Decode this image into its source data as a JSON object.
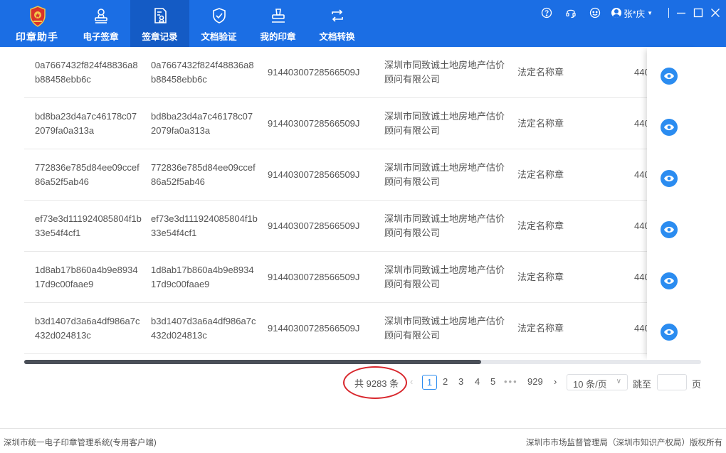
{
  "brand": {
    "name": "印章助手"
  },
  "nav": [
    {
      "label": "电子签章",
      "icon": "user-stamp-icon",
      "active": false
    },
    {
      "label": "签章记录",
      "icon": "record-doc-icon",
      "active": true
    },
    {
      "label": "文档验证",
      "icon": "shield-check-icon",
      "active": false
    },
    {
      "label": "我的印章",
      "icon": "seal-icon",
      "active": false
    },
    {
      "label": "文档转换",
      "icon": "convert-icon",
      "active": false
    }
  ],
  "topbar": {
    "username": "张*庆",
    "icons": [
      "help-icon",
      "headset-icon",
      "smile-icon"
    ]
  },
  "colors": {
    "header": "#1b6ee4",
    "active_tab": "#145bc5",
    "accent": "#2b8cf0",
    "highlight_ring": "#d8262c"
  },
  "table": {
    "rows": [
      {
        "c1": "0a7667432f824f48836a8b88458ebb6c",
        "c2": "0a7667432f824f48836a8b88458ebb6c",
        "c3": "91440300728566509J",
        "c4": "深圳市同致诚土地房地产估价顾问有限公司",
        "c5": "法定名称章",
        "c6": "440"
      },
      {
        "c1": "bd8ba23d4a7c46178c072079fa0a313a",
        "c2": "bd8ba23d4a7c46178c072079fa0a313a",
        "c3": "91440300728566509J",
        "c4": "深圳市同致诚土地房地产估价顾问有限公司",
        "c5": "法定名称章",
        "c6": "440"
      },
      {
        "c1": "772836e785d84ee09ccef86a52f5ab46",
        "c2": "772836e785d84ee09ccef86a52f5ab46",
        "c3": "91440300728566509J",
        "c4": "深圳市同致诚土地房地产估价顾问有限公司",
        "c5": "法定名称章",
        "c6": "440"
      },
      {
        "c1": "ef73e3d111924085804f1b33e54f4cf1",
        "c2": "ef73e3d111924085804f1b33e54f4cf1",
        "c3": "91440300728566509J",
        "c4": "深圳市同致诚土地房地产估价顾问有限公司",
        "c5": "法定名称章",
        "c6": "440"
      },
      {
        "c1": "1d8ab17b860a4b9e893417d9c00faae9",
        "c2": "1d8ab17b860a4b9e893417d9c00faae9",
        "c3": "91440300728566509J",
        "c4": "深圳市同致诚土地房地产估价顾问有限公司",
        "c5": "法定名称章",
        "c6": "440"
      },
      {
        "c1": "b3d1407d3a6a4df986a7c432d024813c",
        "c2": "b3d1407d3a6a4df986a7c432d024813c",
        "c3": "91440300728566509J",
        "c4": "深圳市同致诚土地房地产估价顾问有限公司",
        "c5": "法定名称章",
        "c6": "440"
      }
    ]
  },
  "pagination": {
    "total": "共 9283 条",
    "prev": "‹",
    "pages": [
      "1",
      "2",
      "3",
      "4",
      "5"
    ],
    "current": "1",
    "more": "•••",
    "last": "929",
    "next": "›",
    "page_size": "10 条/页",
    "jump_label": "跳至",
    "jump_value": "",
    "jump_suffix": "页"
  },
  "footer": {
    "left": "深圳市统一电子印章管理系统(专用客户端)",
    "right": "深圳市市场监督管理局（深圳市知识产权局）版权所有"
  }
}
